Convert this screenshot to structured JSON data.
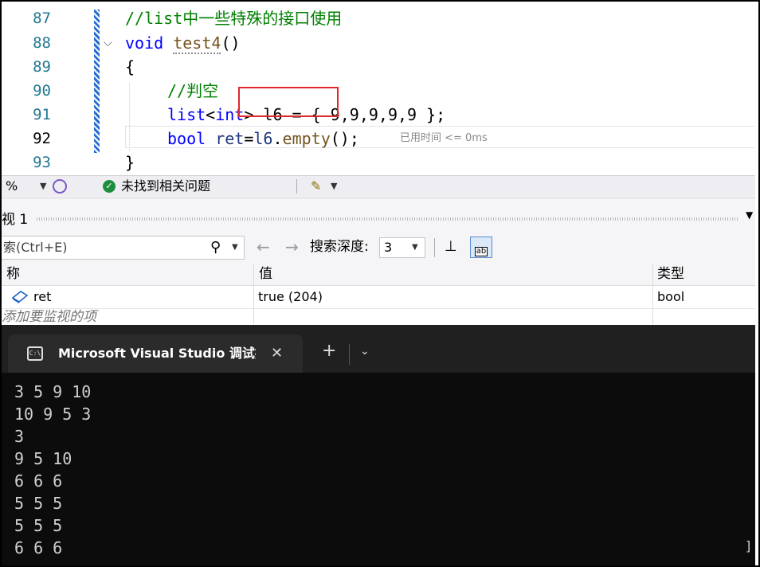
{
  "editor": {
    "lines": [
      {
        "num": "87"
      },
      {
        "num": "88"
      },
      {
        "num": "89"
      },
      {
        "num": "90"
      },
      {
        "num": "91"
      },
      {
        "num": "92"
      },
      {
        "num": "93"
      }
    ],
    "comment1": "//list中一些特殊的接口使用",
    "kw_void": "void",
    "fn_name": "test4",
    "parens": "()",
    "brace_open": "{",
    "comment2": "//判空",
    "kw_list": "list",
    "lt": "<",
    "kw_int": "int",
    "gt": ">",
    "line91_rest": " l6 = { 9,9,9,9,9 };",
    "kw_bool": "bool",
    "var_ret": "ret",
    "eq": "=",
    "var_l6": "l6",
    "dot": ".",
    "fn_empty": "empty",
    "call_end": "();",
    "perf_tip": "已用时间 <= 0ms",
    "brace_close": "}",
    "fold_icon": "chevron-down-icon"
  },
  "statusbar": {
    "zoom": "%",
    "no_issues": "未找到相关问题"
  },
  "watch": {
    "title": "视 1",
    "search_placeholder": "索(Ctrl+E)",
    "back": "←",
    "forward": "→",
    "depth_label": "搜索深度:",
    "depth_value": "3",
    "columns": {
      "name": "称",
      "value": "值",
      "type": "类型"
    },
    "rows": [
      {
        "name": "ret",
        "value": "true (204)",
        "type": "bool"
      }
    ],
    "add_item": "添加要监视的项"
  },
  "terminal": {
    "tab_title": "Microsoft Visual Studio 调试控制台",
    "close": "✕",
    "new_tab": "+",
    "dropdown": "⌄",
    "output": [
      "3 5 9 10",
      "10 9 5 3",
      "3",
      "9 5 10",
      "6 6 6",
      "5 5 5",
      "5 5 5",
      "6 6 6"
    ],
    "scroll_glyph": "]"
  },
  "colors": {
    "keyword": "#0000ff",
    "comment": "#008000",
    "function": "#74531f",
    "line_number": "#237893",
    "highlight_box": "#e2262b",
    "terminal_bg": "#0c0c0c"
  }
}
